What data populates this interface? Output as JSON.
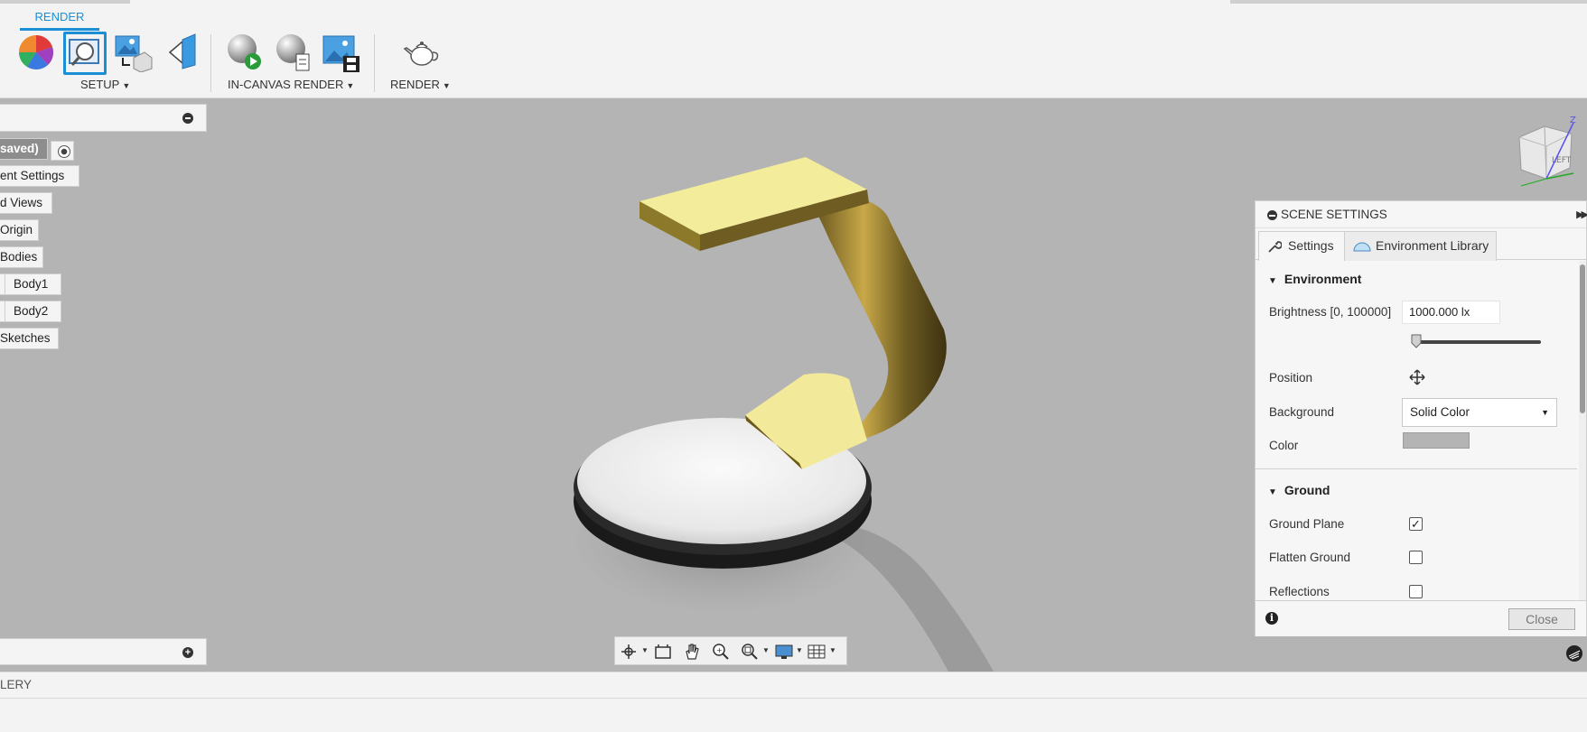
{
  "ribbon": {
    "active_tab": "RENDER",
    "groups": {
      "setup": "SETUP",
      "in_canvas_render": "IN-CANVAS RENDER",
      "render": "RENDER"
    },
    "accent_color": "#1a8fd6"
  },
  "browser": {
    "nodes": [
      {
        "label": "saved)",
        "name": "browser-node-document"
      },
      {
        "label": "ent Settings",
        "name": "browser-node-document-settings"
      },
      {
        "label": "d Views",
        "name": "browser-node-named-views"
      },
      {
        "label": "Origin",
        "name": "browser-node-origin"
      },
      {
        "label": "Bodies",
        "name": "browser-node-bodies"
      },
      {
        "label": "Body1",
        "name": "browser-node-body1"
      },
      {
        "label": "Body2",
        "name": "browser-node-body2"
      },
      {
        "label": "Sketches",
        "name": "browser-node-sketches"
      }
    ]
  },
  "scene_settings": {
    "title": "SCENE SETTINGS",
    "tabs": {
      "settings": "Settings",
      "environment_library": "Environment Library"
    },
    "environment": {
      "heading": "Environment",
      "brightness_label": "Brightness [0, 100000]",
      "brightness_value": "1000.000 lx",
      "brightness_slider_fraction": 0.01,
      "position_label": "Position",
      "background_label": "Background",
      "background_value": "Solid Color",
      "color_label": "Color",
      "color_value": "#b4b4b4"
    },
    "ground": {
      "heading": "Ground",
      "ground_plane_label": "Ground Plane",
      "ground_plane_checked": true,
      "flatten_ground_label": "Flatten Ground",
      "flatten_ground_checked": false,
      "reflections_label": "Reflections",
      "reflections_checked": false
    },
    "close_label": "Close"
  },
  "bottom": {
    "gallery_label": "LERY"
  },
  "viewcube": {
    "face_label": "LEFT",
    "axis_label": "Z"
  }
}
